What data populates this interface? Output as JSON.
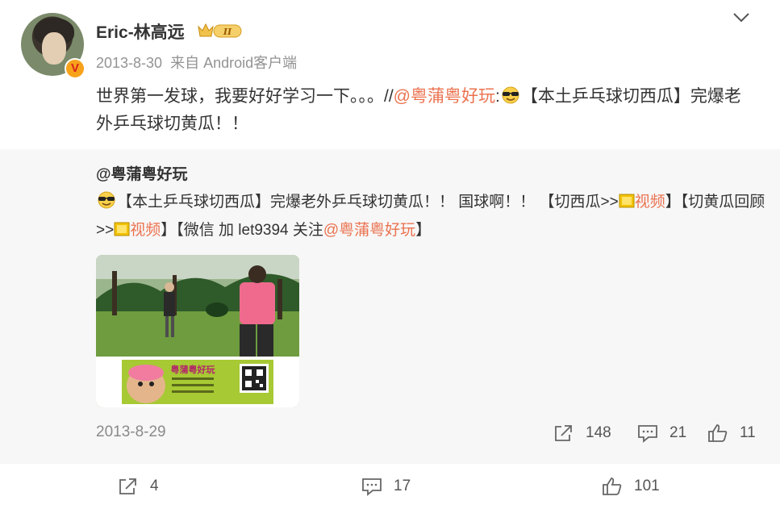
{
  "post": {
    "author": "Eric-林高远",
    "vip_level": "II",
    "verified_mark": "V",
    "date": "2013-8-30",
    "source": "来自 Android客户端",
    "text_a": "世界第一发球，我要好好学习一下。。。//",
    "mention": "@粤蒲粤好玩",
    "text_b": ":",
    "text_c": "【本土乒乓球切西瓜】完爆老外乒乓球切黄瓜！！"
  },
  "retweet": {
    "author": "@粤蒲粤好玩",
    "t1": "【本土乒乓球切西瓜】完爆老外乒乓球切黄瓜！！ 国球啊！！ 【切西瓜>>",
    "video1": "视频",
    "t2": "】【切黄瓜回顾>>",
    "video2": "视频",
    "t3": "】【微信 加 let9394 关注",
    "mention": "@粤蒲粤好玩",
    "t4": "】",
    "date": "2013-8-29",
    "share_count": "148",
    "comment_count": "21",
    "like_count": "11",
    "thumbnail": {
      "banner_title": "粤蒲粤好玩"
    }
  },
  "footer": {
    "share_count": "4",
    "comment_count": "17",
    "like_count": "101"
  },
  "icons": {
    "share": "share-icon",
    "comment": "comment-icon",
    "like": "like-icon",
    "expand": "chevron-down-icon"
  },
  "colors": {
    "link": "#eb7350",
    "retweet_bg": "#f7f7f7",
    "muted": "#939393"
  }
}
